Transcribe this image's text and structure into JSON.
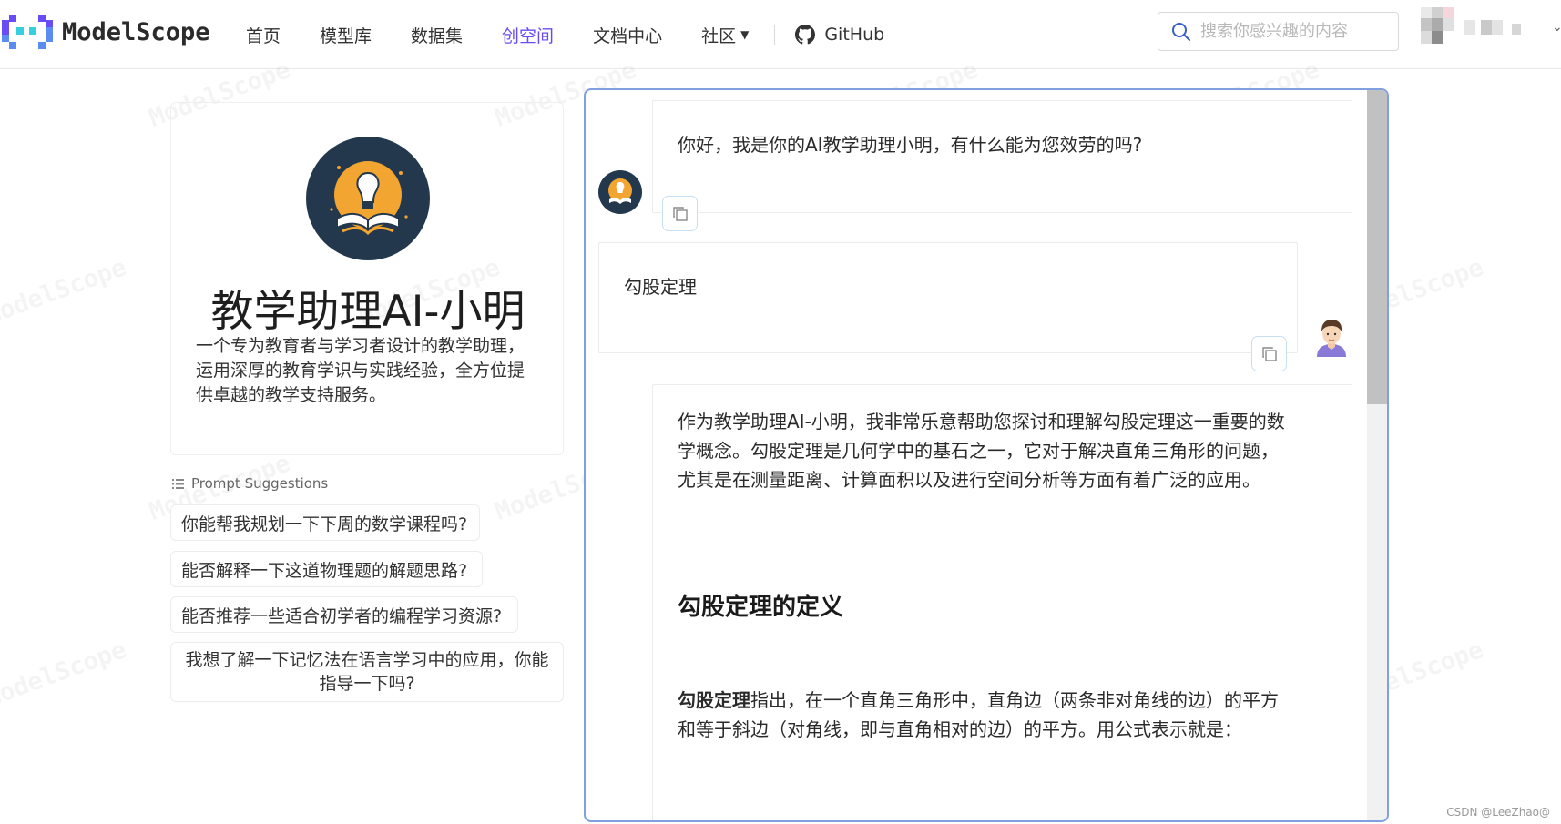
{
  "brand": {
    "name": "ModelScope"
  },
  "nav": {
    "items": [
      {
        "label": "首页",
        "active": false
      },
      {
        "label": "模型库",
        "active": false
      },
      {
        "label": "数据集",
        "active": false
      },
      {
        "label": "创空间",
        "active": true
      },
      {
        "label": "文档中心",
        "active": false
      }
    ],
    "community_label": "社区",
    "github_label": "GitHub"
  },
  "search": {
    "placeholder": "搜索你感兴趣的内容"
  },
  "watermark_text": "ModelScope",
  "profile": {
    "title": "教学助理AI-小明",
    "description": "一个专为教育者与学习者设计的教学助理，运用深厚的教育学识与实践经验，全方位提供卓越的教学支持服务。"
  },
  "prompt_suggestions": {
    "header": "Prompt Suggestions",
    "items": [
      "你能帮我规划一下下周的数学课程吗?",
      "能否解释一下这道物理题的解题思路?",
      "能否推荐一些适合初学者的编程学习资源?",
      "我想了解一下记忆法在语言学习中的应用，你能指导一下吗?"
    ]
  },
  "chat": {
    "greeting": "你好，我是你的AI教学助理小明，有什么能为您效劳的吗?",
    "user_message": "勾股定理",
    "reply": {
      "intro": "作为教学助理AI-小明，我非常乐意帮助您探讨和理解勾股定理这一重要的数学概念。勾股定理是几何学中的基石之一，它对于解决直角三角形的问题，尤其是在测量距离、计算面积以及进行空间分析等方面有着广泛的应用。",
      "heading": "勾股定理的定义",
      "def_bold": "勾股定理",
      "def_rest": "指出，在一个直角三角形中，直角边（两条非对角线的边）的平方和等于斜边（对角线，即与直角相对的边）的平方。用公式表示就是："
    }
  },
  "footer": {
    "credit": "CSDN @LeeZhao@"
  },
  "colors": {
    "accent": "#6a4cf5",
    "panel_border": "#7fa1e0",
    "copy_border": "#c6dff3"
  }
}
